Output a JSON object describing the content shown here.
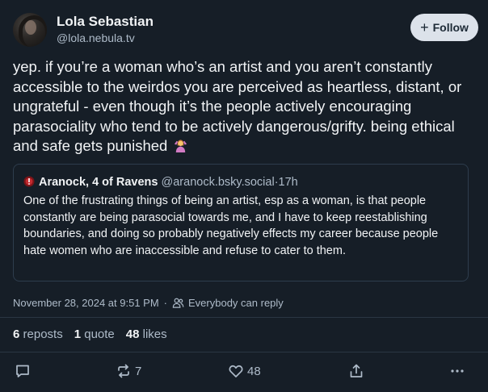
{
  "author": {
    "name": "Lola Sebastian",
    "handle": "@lola.nebula.tv"
  },
  "follow": {
    "label": "Follow"
  },
  "post": {
    "text": "yep. if you’re a woman who’s an artist and you aren’t constantly accessible to the weirdos you are perceived as heartless, distant, or ungrateful - even though it’s the people actively encouraging parasociality who tend to be actively dangerous/grifty. being ethical and safe gets punished",
    "emoji": "person-shrugging-emoji"
  },
  "quote": {
    "author_name": "Aranock, 4 of Ravens",
    "handle": "@aranock.bsky.social",
    "separator": "·",
    "time": "17h",
    "text": "One of the frustrating things of being an artist, esp as a woman, is that people constantly are being parasocial towards me, and I have to keep reestablishing boundaries, and doing so probably negatively effects my career because people hate women who are inaccessible and refuse to cater to them."
  },
  "meta": {
    "date": "November 28, 2024 at 9:51 PM",
    "separator": "·",
    "reply_setting": "Everybody can reply"
  },
  "stats": {
    "reposts_count": "6",
    "reposts_label": "reposts",
    "quotes_count": "1",
    "quotes_label": "quote",
    "likes_count": "48",
    "likes_label": "likes"
  },
  "actions": {
    "repost_count": "7",
    "like_count": "48"
  },
  "icons": [
    "reply-icon",
    "repost-icon",
    "like-icon",
    "share-icon",
    "more-icon",
    "people-icon"
  ],
  "colors": {
    "background": "#161e27",
    "text": "#f1f3f5",
    "muted": "#aebbc9",
    "border": "#2e3d4d",
    "follow_bg": "#dce2ea"
  }
}
